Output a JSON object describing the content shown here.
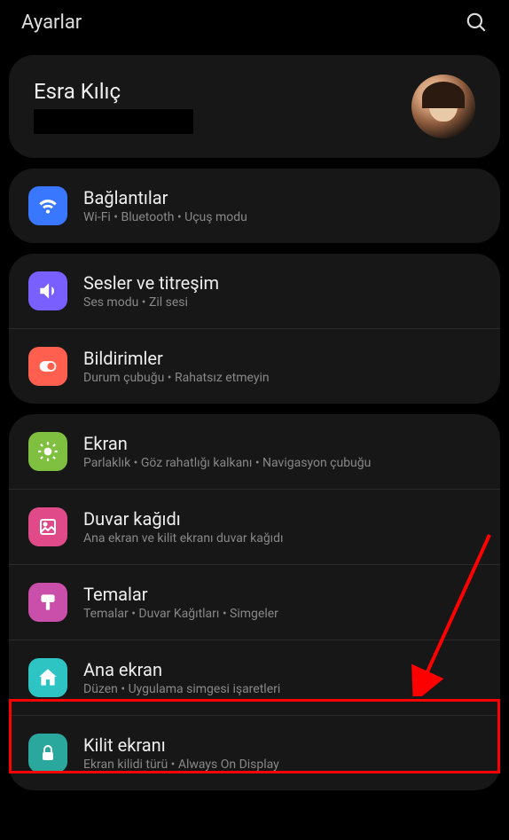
{
  "header": {
    "title": "Ayarlar"
  },
  "profile": {
    "name": "Esra Kılıç"
  },
  "groups": [
    {
      "items": [
        {
          "key": "connections",
          "title": "Bağlantılar",
          "sub": "Wi-Fi  •  Bluetooth  •  Uçuş modu",
          "color": "ic-blue",
          "icon": "wifi"
        }
      ]
    },
    {
      "items": [
        {
          "key": "sounds",
          "title": "Sesler ve titreşim",
          "sub": "Ses modu  •  Zil sesi",
          "color": "ic-purple",
          "icon": "sound"
        },
        {
          "key": "notifications",
          "title": "Bildirimler",
          "sub": "Durum çubuğu  •  Rahatsız etmeyin",
          "color": "ic-orange",
          "icon": "notif"
        }
      ]
    },
    {
      "items": [
        {
          "key": "display",
          "title": "Ekran",
          "sub": "Parlaklık  •  Göz rahatlığı kalkanı  •  Navigasyon çubuğu",
          "color": "ic-green",
          "icon": "sun"
        },
        {
          "key": "wallpaper",
          "title": "Duvar kağıdı",
          "sub": "Ana ekran ve kilit ekranı duvar kağıdı",
          "color": "ic-pink",
          "icon": "image"
        },
        {
          "key": "themes",
          "title": "Temalar",
          "sub": "Temalar  •  Duvar Kağıtları  •  Simgeler",
          "color": "ic-magenta",
          "icon": "brush"
        },
        {
          "key": "home",
          "title": "Ana ekran",
          "sub": "Düzen  •  Uygulama simgesi işaretleri",
          "color": "ic-teal",
          "icon": "house"
        },
        {
          "key": "lock",
          "title": "Kilit ekranı",
          "sub": "Ekran kilidi türü  •  Always On Display",
          "color": "ic-tealdark",
          "icon": "lock"
        }
      ]
    }
  ]
}
